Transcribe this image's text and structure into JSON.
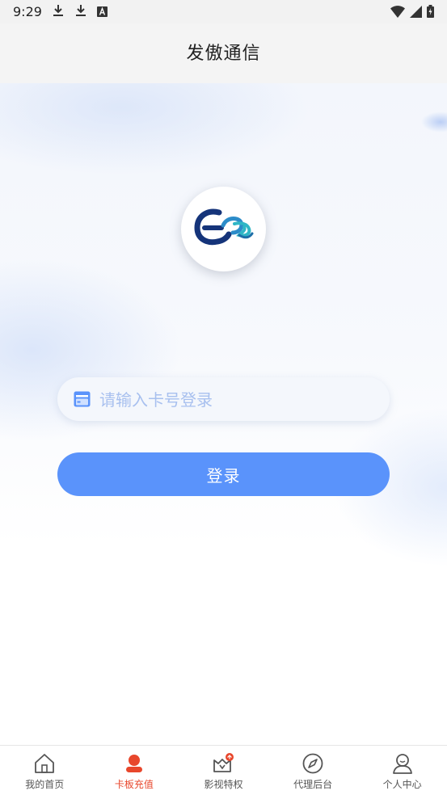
{
  "status_bar": {
    "time": "9:29",
    "left_icons": [
      "download-icon",
      "download-icon",
      "font-a-icon"
    ],
    "right_icons": [
      "wifi-icon",
      "signal-icon",
      "battery-icon"
    ]
  },
  "header": {
    "title": "发傲通信"
  },
  "login": {
    "logo_icon": "app-logo-icon",
    "card_input": {
      "placeholder": "请输入卡号登录",
      "value": "",
      "icon": "card-icon"
    },
    "button_label": "登录"
  },
  "bottom_nav": {
    "active_index": 1,
    "items": [
      {
        "label": "我的首页",
        "icon": "home-icon"
      },
      {
        "label": "卡板充值",
        "icon": "user-recharge-icon"
      },
      {
        "label": "影视特权",
        "icon": "crown-basket-icon"
      },
      {
        "label": "代理后台",
        "icon": "compass-icon"
      },
      {
        "label": "个人中心",
        "icon": "person-icon"
      }
    ]
  },
  "colors": {
    "accent": "#5a93fb",
    "active_nav": "#e8472c",
    "placeholder": "#a8c0ef"
  }
}
